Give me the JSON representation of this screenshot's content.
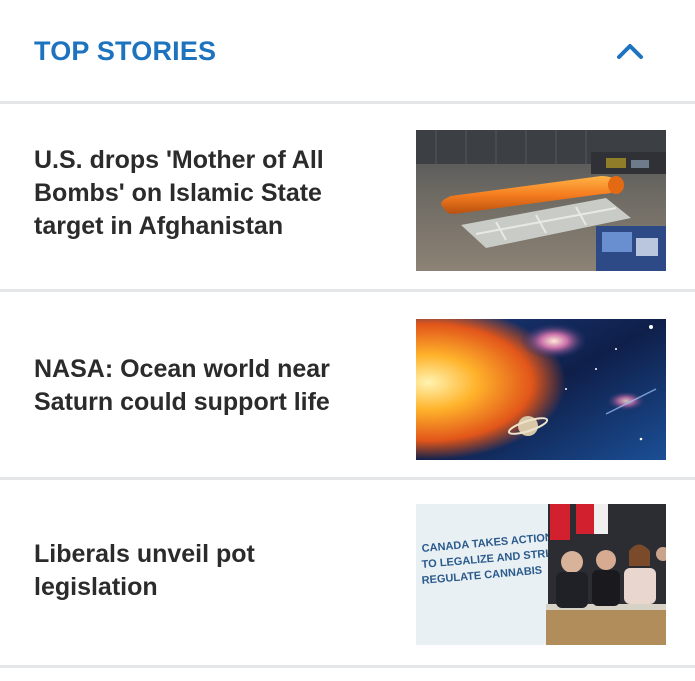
{
  "section": {
    "title": "TOP STORIES",
    "collapse_icon": "chevron-up-icon",
    "accent_color": "#1e73be"
  },
  "stories": [
    {
      "headline": "U.S. drops 'Mother of All Bombs' on Islamic State target in Afghanistan",
      "image_alt": "Orange bomb on a cradle inside a hangar"
    },
    {
      "headline": "NASA: Ocean world near Saturn could support life",
      "image_alt": "Sun, Saturn and galaxies in space"
    },
    {
      "headline": "Liberals unveil pot legislation",
      "image_alt": "Press conference with officials",
      "image_text": [
        "CANADA TAKES ACTION",
        "TO LEGALIZE AND STRICTLY",
        "REGULATE CANNABIS"
      ]
    }
  ]
}
